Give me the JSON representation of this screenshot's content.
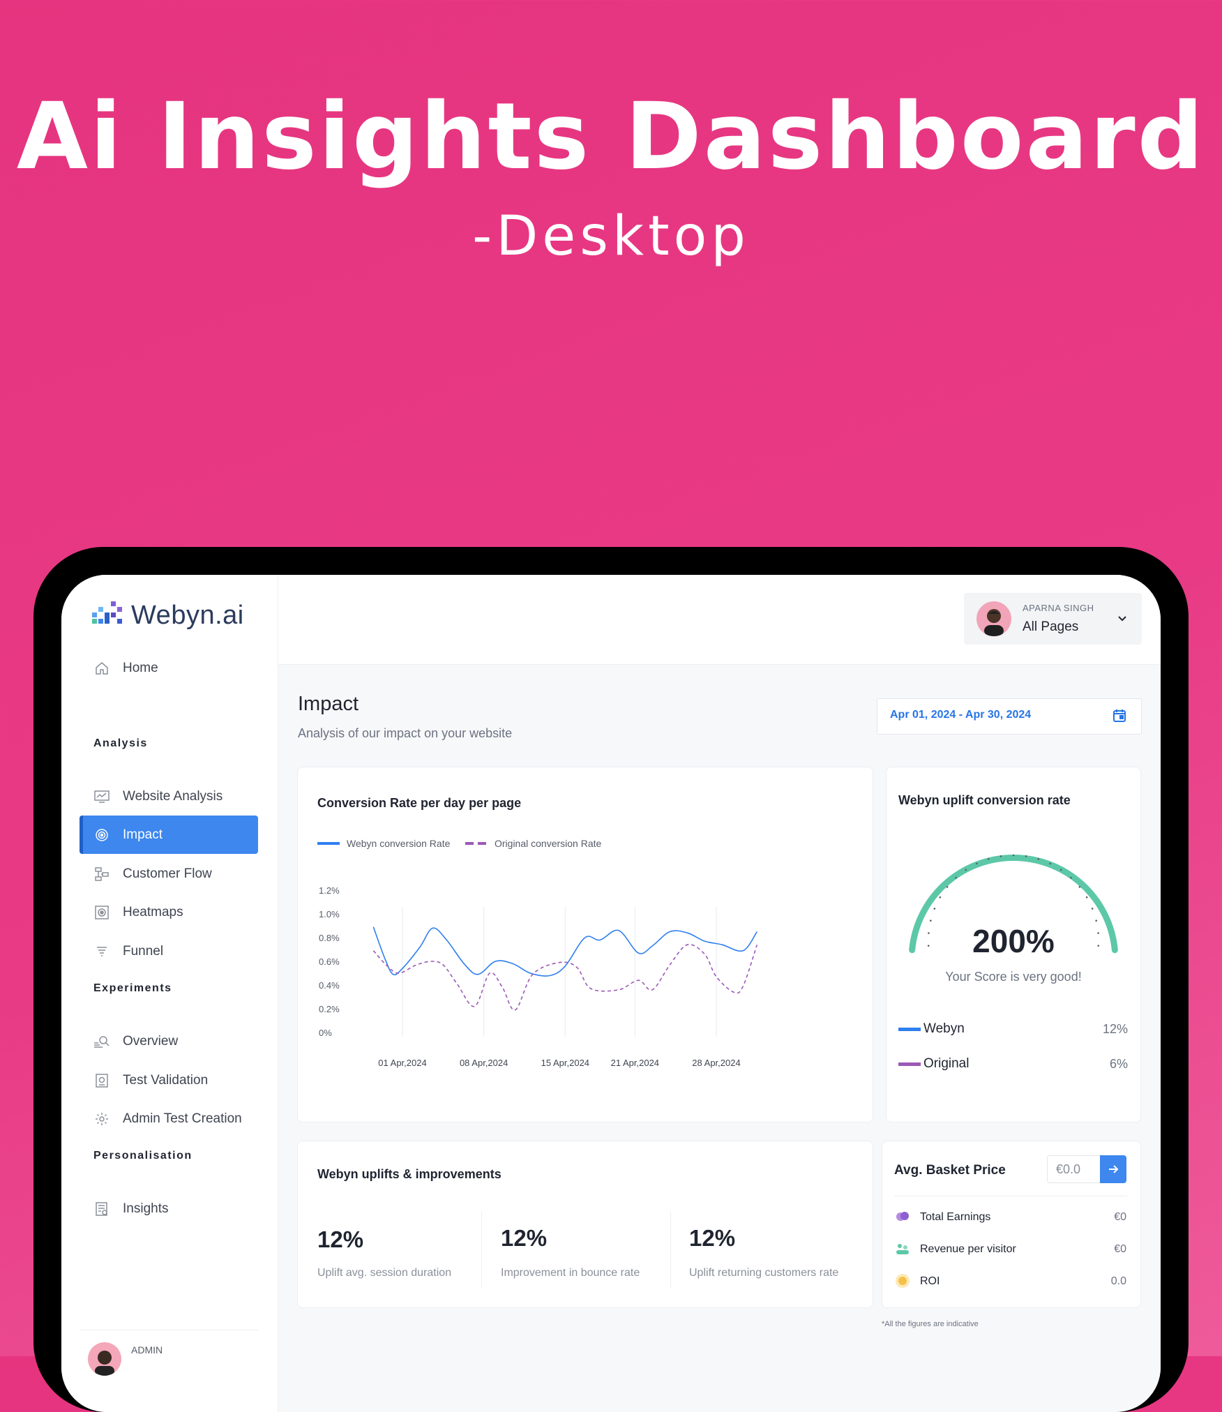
{
  "hero": {
    "title": "Ai Insights Dashboard",
    "subtitle": "-Desktop"
  },
  "brand": {
    "name": "Webyn",
    "suffix": ".ai"
  },
  "sidebar": {
    "home": "Home",
    "sections": {
      "analysis": "Analysis",
      "experiments": "Experiments",
      "personalisation": "Personalisation"
    },
    "items": {
      "website_analysis": "Website Analysis",
      "impact": "Impact",
      "customer_flow": "Customer Flow",
      "heatmaps": "Heatmaps",
      "funnel": "Funnel",
      "overview": "Overview",
      "test_validation": "Test Validation",
      "admin_test_creation": "Admin Test Creation",
      "insights": "Insights"
    },
    "admin_label": "ADMIN"
  },
  "user": {
    "name": "APARNA SINGH",
    "selector": "All Pages"
  },
  "page": {
    "title": "Impact",
    "subtitle": "Analysis of our impact on your website",
    "date_range": "Apr 01, 2024 - Apr 30, 2024"
  },
  "conversion_card": {
    "title": "Conversion Rate per day per page",
    "legend_webyn": "Webyn conversion Rate",
    "legend_original": "Original conversion Rate"
  },
  "chart_data": {
    "type": "line",
    "title": "Conversion Rate per day per page",
    "xlabel": "",
    "ylabel": "",
    "y_ticks": [
      "1.2%",
      "1.0%",
      "0.8%",
      "0.6%",
      "0.4%",
      "0.2%",
      "0%"
    ],
    "ylim": [
      0,
      1.2
    ],
    "x_ticks": [
      "01 Apr,2024",
      "08 Apr,2024",
      "15 Apr,2024",
      "21 Apr,2024",
      "28 Apr,2024"
    ],
    "grid": "vertical",
    "legend": "top-left",
    "series": [
      {
        "name": "Webyn conversion Rate",
        "color": "#2f7fef",
        "style": "solid",
        "points": [
          [
            -2.5,
            0.89
          ],
          [
            -1.5,
            0.62
          ],
          [
            -0.8,
            0.49
          ],
          [
            0,
            0.54
          ],
          [
            1.5,
            0.72
          ],
          [
            2.6,
            0.88
          ],
          [
            3.8,
            0.78
          ],
          [
            5.3,
            0.58
          ],
          [
            6.5,
            0.49
          ],
          [
            8,
            0.6
          ],
          [
            9.5,
            0.58
          ],
          [
            11,
            0.5
          ],
          [
            12.7,
            0.48
          ],
          [
            14,
            0.56
          ],
          [
            15.7,
            0.8
          ],
          [
            17,
            0.78
          ],
          [
            18.6,
            0.86
          ],
          [
            20.3,
            0.67
          ],
          [
            21.5,
            0.73
          ],
          [
            23,
            0.85
          ],
          [
            24.5,
            0.84
          ],
          [
            26,
            0.77
          ],
          [
            27.5,
            0.74
          ],
          [
            29.3,
            0.69
          ],
          [
            30.5,
            0.85
          ]
        ]
      },
      {
        "name": "Original conversion Rate",
        "color": "#9b59b6",
        "style": "dashed",
        "points": [
          [
            -2.5,
            0.69
          ],
          [
            -1.3,
            0.56
          ],
          [
            -0.3,
            0.5
          ],
          [
            1.2,
            0.57
          ],
          [
            2.5,
            0.6
          ],
          [
            3.5,
            0.57
          ],
          [
            4.7,
            0.41
          ],
          [
            6.2,
            0.22
          ],
          [
            7.5,
            0.5
          ],
          [
            8.6,
            0.38
          ],
          [
            9.7,
            0.19
          ],
          [
            11.2,
            0.49
          ],
          [
            13.5,
            0.59
          ],
          [
            15,
            0.55
          ],
          [
            16.2,
            0.37
          ],
          [
            18.6,
            0.36
          ],
          [
            20.3,
            0.44
          ],
          [
            21.5,
            0.36
          ],
          [
            23,
            0.57
          ],
          [
            24.5,
            0.74
          ],
          [
            26,
            0.66
          ],
          [
            27,
            0.47
          ],
          [
            28.5,
            0.34
          ],
          [
            29.3,
            0.39
          ],
          [
            30.5,
            0.74
          ]
        ]
      }
    ]
  },
  "gauge": {
    "title": "Webyn uplift conversion rate",
    "value": "200%",
    "level": 1.0,
    "caption": "Your Score is very good!",
    "webyn_label": "Webyn",
    "webyn_value": "12%",
    "original_label": "Original",
    "original_value": "6%",
    "colors": {
      "arc": "#5cc8a8",
      "webyn": "#2f7fef",
      "original": "#9b59b6"
    }
  },
  "uplifts": {
    "title": "Webyn uplifts & improvements",
    "stats": [
      {
        "value": "12%",
        "label": "Uplift avg. session duration"
      },
      {
        "value": "12%",
        "label": "Improvement in bounce rate"
      },
      {
        "value": "12%",
        "label": "Uplift returning customers rate"
      }
    ]
  },
  "basket": {
    "title": "Avg. Basket Price",
    "input_value": "€0.0",
    "rows": [
      {
        "label": "Total Earnings",
        "value": "€0",
        "icon": "coins-icon"
      },
      {
        "label": "Revenue per visitor",
        "value": "€0",
        "icon": "visitors-icon"
      },
      {
        "label": "ROI",
        "value": "0.0",
        "icon": "roi-icon"
      }
    ],
    "footnote": "*All the figures are indicative"
  },
  "colors": {
    "accent": "#3d87ee",
    "brand_bg": "#e6347f"
  }
}
